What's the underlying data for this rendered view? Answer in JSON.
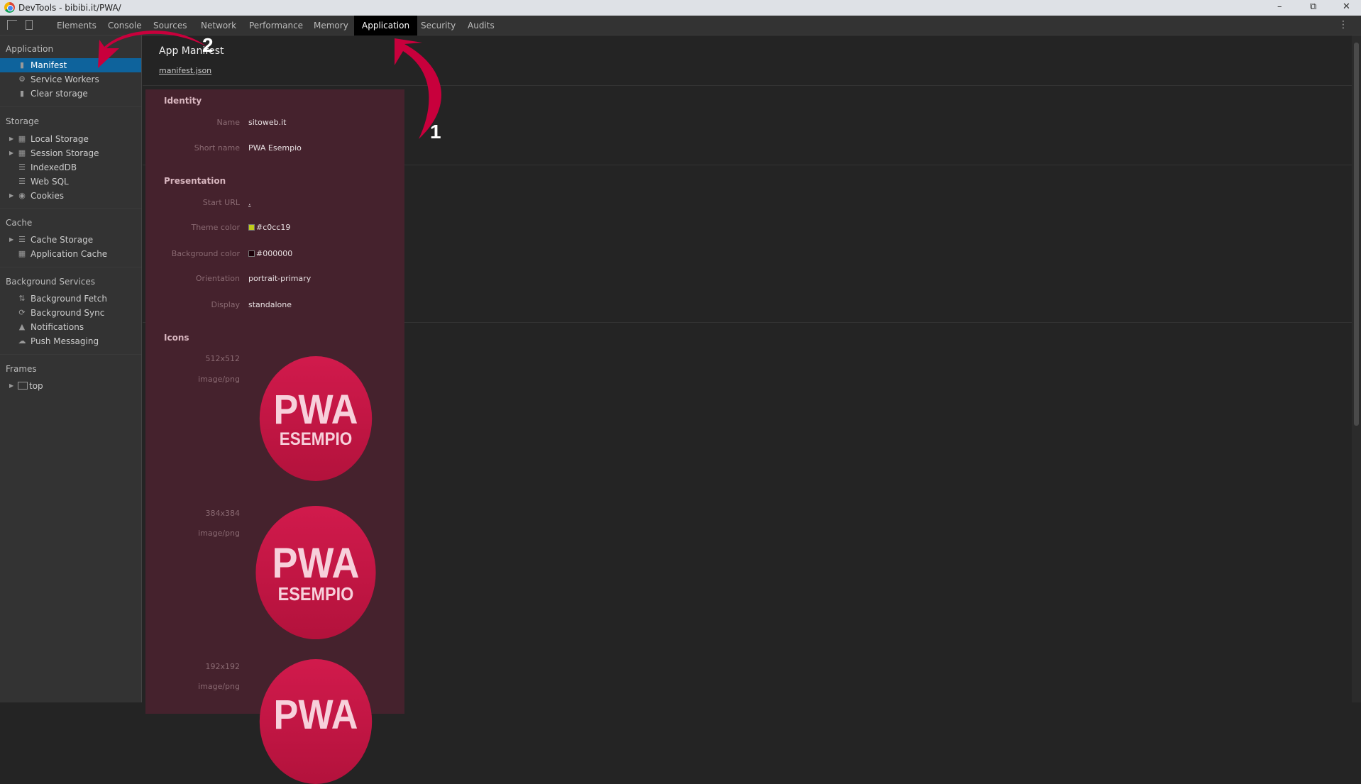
{
  "window": {
    "title": "DevTools - bibibi.it/PWA/"
  },
  "tabs": [
    "Elements",
    "Console",
    "Sources",
    "Network",
    "Performance",
    "Memory",
    "Application",
    "Security",
    "Audits"
  ],
  "active_tab": "Application",
  "sidebar": {
    "application": {
      "header": "Application",
      "items": [
        "Manifest",
        "Service Workers",
        "Clear storage"
      ]
    },
    "storage": {
      "header": "Storage",
      "items": [
        "Local Storage",
        "Session Storage",
        "IndexedDB",
        "Web SQL",
        "Cookies"
      ]
    },
    "cache": {
      "header": "Cache",
      "items": [
        "Cache Storage",
        "Application Cache"
      ]
    },
    "background": {
      "header": "Background Services",
      "items": [
        "Background Fetch",
        "Background Sync",
        "Notifications",
        "Push Messaging"
      ]
    },
    "frames": {
      "header": "Frames",
      "items": [
        "top"
      ]
    }
  },
  "main": {
    "title": "App Manifest",
    "link": "manifest.json",
    "identity": {
      "header": "Identity",
      "name_label": "Name",
      "name": "sitoweb.it",
      "short_label": "Short name",
      "short": "PWA Esempio"
    },
    "presentation": {
      "header": "Presentation",
      "start_label": "Start URL",
      "start": ".",
      "theme_label": "Theme color",
      "theme": "#c0cc19",
      "bg_label": "Background color",
      "bg": "#000000",
      "orient_label": "Orientation",
      "orient": "portrait-primary",
      "display_label": "Display",
      "display": "standalone"
    },
    "icons": {
      "header": "Icons",
      "list": [
        {
          "size": "512x512",
          "type": "image/png"
        },
        {
          "size": "384x384",
          "type": "image/png"
        },
        {
          "size": "192x192",
          "type": "image/png"
        }
      ],
      "logo_line1": "PWA",
      "logo_line2": "ESEMPIO"
    }
  },
  "annotations": {
    "one": "1",
    "two": "2",
    "color": "#c8003c"
  }
}
